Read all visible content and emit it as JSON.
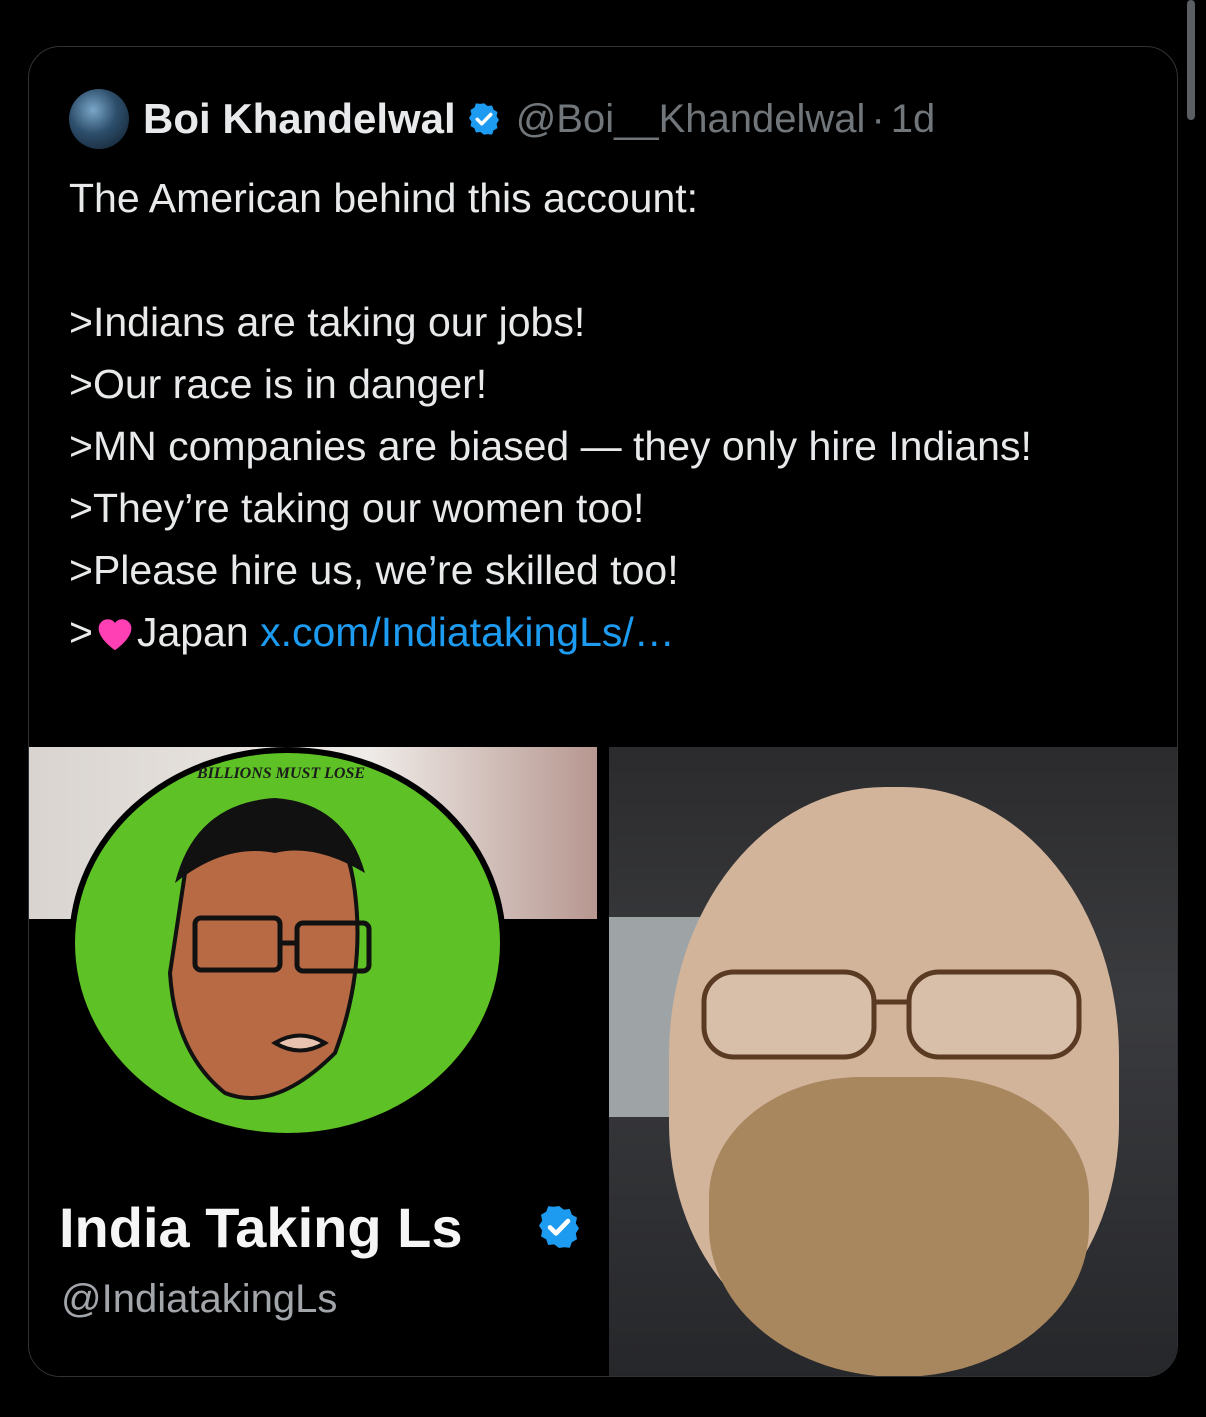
{
  "tweet": {
    "author_name": "Boi Khandelwal",
    "author_handle": "@Boi__Khandelwal",
    "separator": "·",
    "time": "1d",
    "line1": "The American behind this account:",
    "line2": ">Indians are taking our jobs!",
    "line3": ">Our race is in danger!",
    "line4": ">MN companies are biased — they only hire Indians!",
    "line5": ">They’re taking our women too!",
    "line6": ">Please hire us, we’re skilled too!",
    "line7_prefix": ">",
    "line7_text": "Japan ",
    "link": "x.com/IndiatakingLs/…"
  },
  "media": {
    "left": {
      "logo_text": "BILLIONS MUST LOSE",
      "account_name": "India Taking Ls",
      "account_handle": "@IndiatakingLs"
    }
  },
  "colors": {
    "verified": "#1d9bf0",
    "link": "#1d9bf0",
    "muted": "#71767b",
    "logo_green": "#5ec125",
    "heart": "#ff3fb4"
  }
}
